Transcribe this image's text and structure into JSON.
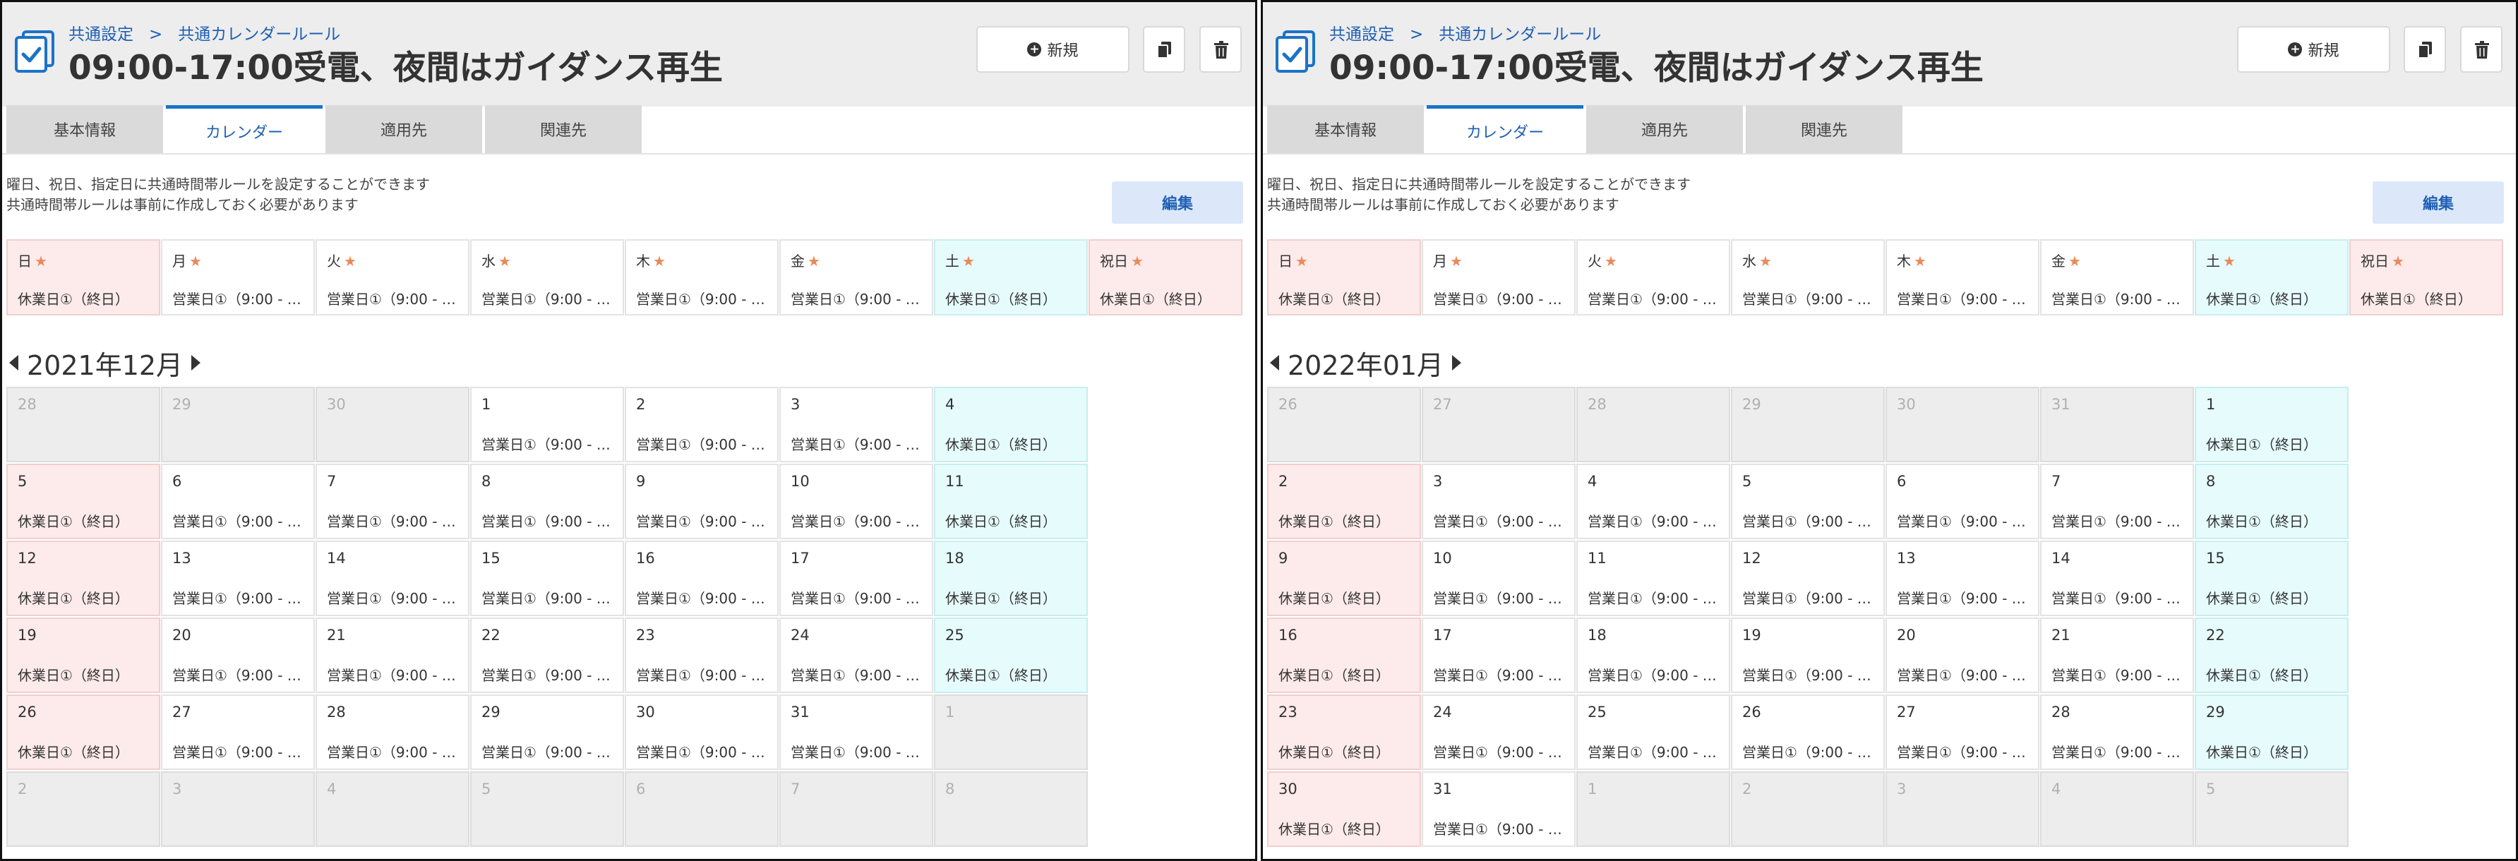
{
  "panels": [
    {
      "breadcrumb": [
        "共通設定",
        "共通カレンダールール"
      ],
      "breadcrumb_sep": ">",
      "title": "09:00-17:00受電、夜間はガイダンス再生",
      "new_button": "新規",
      "tabs": [
        "基本情報",
        "カレンダー",
        "適用先",
        "関連先"
      ],
      "active_tab": 1,
      "desc": [
        "曜日、祝日、指定日に共通時間帯ルールを設定することができます",
        "共通時間帯ルールは事前に作成しておく必要があります"
      ],
      "edit_button": "編集",
      "weekdays": [
        {
          "day": "日",
          "star": "★",
          "rule": "休業日①（終日）",
          "kind": "hol"
        },
        {
          "day": "月",
          "star": "★",
          "rule": "営業日①（9:00 - …",
          "kind": ""
        },
        {
          "day": "火",
          "star": "★",
          "rule": "営業日①（9:00 - …",
          "kind": ""
        },
        {
          "day": "水",
          "star": "★",
          "rule": "営業日①（9:00 - …",
          "kind": ""
        },
        {
          "day": "木",
          "star": "★",
          "rule": "営業日①（9:00 - …",
          "kind": ""
        },
        {
          "day": "金",
          "star": "★",
          "rule": "営業日①（9:00 - …",
          "kind": ""
        },
        {
          "day": "土",
          "star": "★",
          "rule": "休業日①（終日）",
          "kind": "sat"
        },
        {
          "day": "祝日",
          "star": "★",
          "rule": "休業日①（終日）",
          "kind": "hol"
        }
      ],
      "month": "2021年12月",
      "days": [
        {
          "n": "28",
          "r": "",
          "k": "out"
        },
        {
          "n": "29",
          "r": "",
          "k": "out"
        },
        {
          "n": "30",
          "r": "",
          "k": "out"
        },
        {
          "n": "1",
          "r": "営業日①（9:00 - …",
          "k": ""
        },
        {
          "n": "2",
          "r": "営業日①（9:00 - …",
          "k": ""
        },
        {
          "n": "3",
          "r": "営業日①（9:00 - …",
          "k": ""
        },
        {
          "n": "4",
          "r": "休業日①（終日）",
          "k": "sat"
        },
        {
          "n": "5",
          "r": "休業日①（終日）",
          "k": "hol"
        },
        {
          "n": "6",
          "r": "営業日①（9:00 - …",
          "k": ""
        },
        {
          "n": "7",
          "r": "営業日①（9:00 - …",
          "k": ""
        },
        {
          "n": "8",
          "r": "営業日①（9:00 - …",
          "k": ""
        },
        {
          "n": "9",
          "r": "営業日①（9:00 - …",
          "k": ""
        },
        {
          "n": "10",
          "r": "営業日①（9:00 - …",
          "k": ""
        },
        {
          "n": "11",
          "r": "休業日①（終日）",
          "k": "sat"
        },
        {
          "n": "12",
          "r": "休業日①（終日）",
          "k": "hol"
        },
        {
          "n": "13",
          "r": "営業日①（9:00 - …",
          "k": ""
        },
        {
          "n": "14",
          "r": "営業日①（9:00 - …",
          "k": ""
        },
        {
          "n": "15",
          "r": "営業日①（9:00 - …",
          "k": ""
        },
        {
          "n": "16",
          "r": "営業日①（9:00 - …",
          "k": ""
        },
        {
          "n": "17",
          "r": "営業日①（9:00 - …",
          "k": ""
        },
        {
          "n": "18",
          "r": "休業日①（終日）",
          "k": "sat"
        },
        {
          "n": "19",
          "r": "休業日①（終日）",
          "k": "hol"
        },
        {
          "n": "20",
          "r": "営業日①（9:00 - …",
          "k": ""
        },
        {
          "n": "21",
          "r": "営業日①（9:00 - …",
          "k": ""
        },
        {
          "n": "22",
          "r": "営業日①（9:00 - …",
          "k": ""
        },
        {
          "n": "23",
          "r": "営業日①（9:00 - …",
          "k": ""
        },
        {
          "n": "24",
          "r": "営業日①（9:00 - …",
          "k": ""
        },
        {
          "n": "25",
          "r": "休業日①（終日）",
          "k": "sat"
        },
        {
          "n": "26",
          "r": "休業日①（終日）",
          "k": "hol"
        },
        {
          "n": "27",
          "r": "営業日①（9:00 - …",
          "k": ""
        },
        {
          "n": "28",
          "r": "営業日①（9:00 - …",
          "k": ""
        },
        {
          "n": "29",
          "r": "営業日①（9:00 - …",
          "k": ""
        },
        {
          "n": "30",
          "r": "営業日①（9:00 - …",
          "k": ""
        },
        {
          "n": "31",
          "r": "営業日①（9:00 - …",
          "k": ""
        },
        {
          "n": "1",
          "r": "",
          "k": "out"
        },
        {
          "n": "2",
          "r": "",
          "k": "out"
        },
        {
          "n": "3",
          "r": "",
          "k": "out"
        },
        {
          "n": "4",
          "r": "",
          "k": "out"
        },
        {
          "n": "5",
          "r": "",
          "k": "out"
        },
        {
          "n": "6",
          "r": "",
          "k": "out"
        },
        {
          "n": "7",
          "r": "",
          "k": "out"
        },
        {
          "n": "8",
          "r": "",
          "k": "out"
        }
      ]
    },
    {
      "breadcrumb": [
        "共通設定",
        "共通カレンダールール"
      ],
      "breadcrumb_sep": ">",
      "title": "09:00-17:00受電、夜間はガイダンス再生",
      "new_button": "新規",
      "tabs": [
        "基本情報",
        "カレンダー",
        "適用先",
        "関連先"
      ],
      "active_tab": 1,
      "desc": [
        "曜日、祝日、指定日に共通時間帯ルールを設定することができます",
        "共通時間帯ルールは事前に作成しておく必要があります"
      ],
      "edit_button": "編集",
      "weekdays": [
        {
          "day": "日",
          "star": "★",
          "rule": "休業日①（終日）",
          "kind": "hol"
        },
        {
          "day": "月",
          "star": "★",
          "rule": "営業日①（9:00 - …",
          "kind": ""
        },
        {
          "day": "火",
          "star": "★",
          "rule": "営業日①（9:00 - …",
          "kind": ""
        },
        {
          "day": "水",
          "star": "★",
          "rule": "営業日①（9:00 - …",
          "kind": ""
        },
        {
          "day": "木",
          "star": "★",
          "rule": "営業日①（9:00 - …",
          "kind": ""
        },
        {
          "day": "金",
          "star": "★",
          "rule": "営業日①（9:00 - …",
          "kind": ""
        },
        {
          "day": "土",
          "star": "★",
          "rule": "休業日①（終日）",
          "kind": "sat"
        },
        {
          "day": "祝日",
          "star": "★",
          "rule": "休業日①（終日）",
          "kind": "hol"
        }
      ],
      "month": "2022年01月",
      "days": [
        {
          "n": "26",
          "r": "",
          "k": "out"
        },
        {
          "n": "27",
          "r": "",
          "k": "out"
        },
        {
          "n": "28",
          "r": "",
          "k": "out"
        },
        {
          "n": "29",
          "r": "",
          "k": "out"
        },
        {
          "n": "30",
          "r": "",
          "k": "out"
        },
        {
          "n": "31",
          "r": "",
          "k": "out"
        },
        {
          "n": "1",
          "r": "休業日①（終日）",
          "k": "sat"
        },
        {
          "n": "2",
          "r": "休業日①（終日）",
          "k": "hol"
        },
        {
          "n": "3",
          "r": "営業日①（9:00 - …",
          "k": ""
        },
        {
          "n": "4",
          "r": "営業日①（9:00 - …",
          "k": ""
        },
        {
          "n": "5",
          "r": "営業日①（9:00 - …",
          "k": ""
        },
        {
          "n": "6",
          "r": "営業日①（9:00 - …",
          "k": ""
        },
        {
          "n": "7",
          "r": "営業日①（9:00 - …",
          "k": ""
        },
        {
          "n": "8",
          "r": "休業日①（終日）",
          "k": "sat"
        },
        {
          "n": "9",
          "r": "休業日①（終日）",
          "k": "hol"
        },
        {
          "n": "10",
          "r": "営業日①（9:00 - …",
          "k": ""
        },
        {
          "n": "11",
          "r": "営業日①（9:00 - …",
          "k": ""
        },
        {
          "n": "12",
          "r": "営業日①（9:00 - …",
          "k": ""
        },
        {
          "n": "13",
          "r": "営業日①（9:00 - …",
          "k": ""
        },
        {
          "n": "14",
          "r": "営業日①（9:00 - …",
          "k": ""
        },
        {
          "n": "15",
          "r": "休業日①（終日）",
          "k": "sat"
        },
        {
          "n": "16",
          "r": "休業日①（終日）",
          "k": "hol"
        },
        {
          "n": "17",
          "r": "営業日①（9:00 - …",
          "k": ""
        },
        {
          "n": "18",
          "r": "営業日①（9:00 - …",
          "k": ""
        },
        {
          "n": "19",
          "r": "営業日①（9:00 - …",
          "k": ""
        },
        {
          "n": "20",
          "r": "営業日①（9:00 - …",
          "k": ""
        },
        {
          "n": "21",
          "r": "営業日①（9:00 - …",
          "k": ""
        },
        {
          "n": "22",
          "r": "休業日①（終日）",
          "k": "sat"
        },
        {
          "n": "23",
          "r": "休業日①（終日）",
          "k": "hol"
        },
        {
          "n": "24",
          "r": "営業日①（9:00 - …",
          "k": ""
        },
        {
          "n": "25",
          "r": "営業日①（9:00 - …",
          "k": ""
        },
        {
          "n": "26",
          "r": "営業日①（9:00 - …",
          "k": ""
        },
        {
          "n": "27",
          "r": "営業日①（9:00 - …",
          "k": ""
        },
        {
          "n": "28",
          "r": "営業日①（9:00 - …",
          "k": ""
        },
        {
          "n": "29",
          "r": "休業日①（終日）",
          "k": "sat"
        },
        {
          "n": "30",
          "r": "休業日①（終日）",
          "k": "hol"
        },
        {
          "n": "31",
          "r": "営業日①（9:00 - …",
          "k": ""
        },
        {
          "n": "1",
          "r": "",
          "k": "out"
        },
        {
          "n": "2",
          "r": "",
          "k": "out"
        },
        {
          "n": "3",
          "r": "",
          "k": "out"
        },
        {
          "n": "4",
          "r": "",
          "k": "out"
        },
        {
          "n": "5",
          "r": "",
          "k": "out"
        }
      ]
    }
  ],
  "colors": {
    "accent": "#1a73c8",
    "link": "#1f5fb4",
    "holiday_bg": "#fdeaea",
    "saturday_bg": "#e6fbfb",
    "outside_bg": "#ededed",
    "star": "#e88a5a"
  },
  "icons": {
    "page": "calendar-check-icon",
    "new": "plus-circle-icon",
    "copy": "copy-icon",
    "delete": "trash-icon",
    "prev": "caret-left-icon",
    "next": "caret-right-icon"
  }
}
